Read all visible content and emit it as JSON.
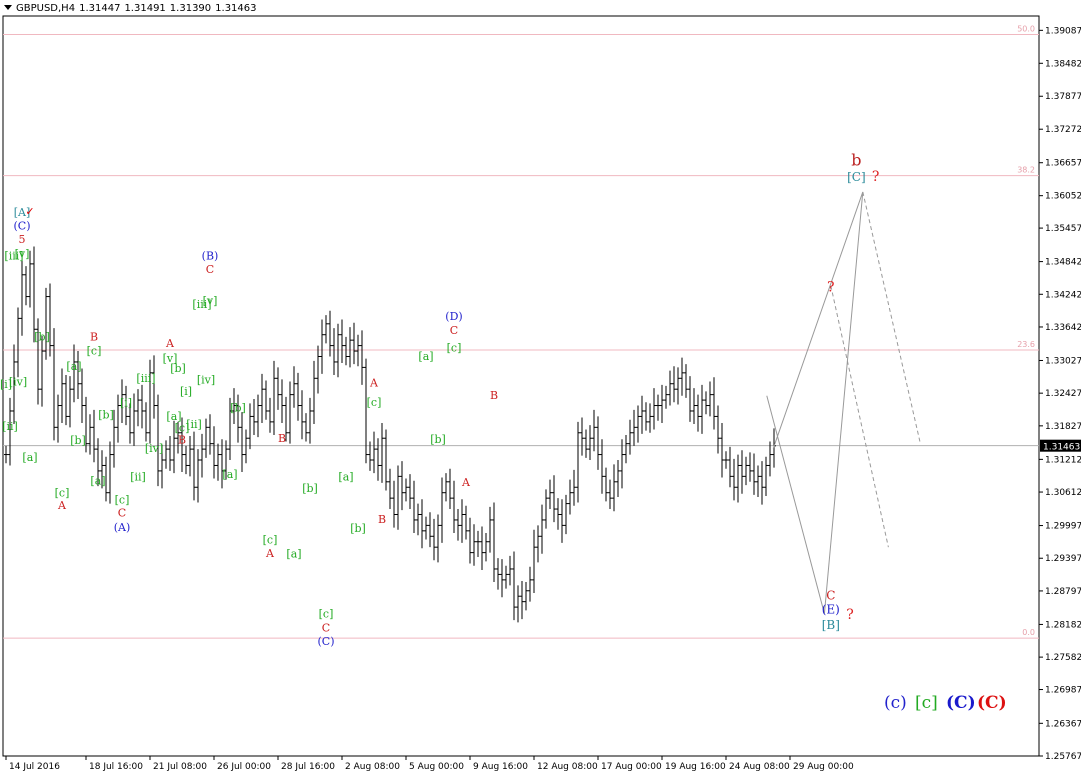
{
  "window": {
    "symbol": "GBPUSD,H4",
    "ohlc": [
      "1.31447",
      "1.31491",
      "1.31390",
      "1.31463"
    ],
    "last_price": "1.31463"
  },
  "chart_data": {
    "type": "candlestick",
    "ylim": [
      1.25767,
      1.3935
    ],
    "yticks": [
      "1.39087",
      "1.38482",
      "1.37877",
      "1.37272",
      "1.36657",
      "1.36052",
      "1.35457",
      "1.34842",
      "1.34242",
      "1.33642",
      "1.33027",
      "1.32427",
      "1.31827",
      "1.31212",
      "1.30612",
      "1.29997",
      "1.29397",
      "1.28797",
      "1.28182",
      "1.27582",
      "1.26987",
      "1.26367",
      "1.25767"
    ],
    "xticks": [
      {
        "label": "14 Jul 2016",
        "bar": 0
      },
      {
        "label": "18 Jul 16:00",
        "bar": 20
      },
      {
        "label": "21 Jul 08:00",
        "bar": 36
      },
      {
        "label": "26 Jul 00:00",
        "bar": 52
      },
      {
        "label": "28 Jul 16:00",
        "bar": 68
      },
      {
        "label": "2 Aug 08:00",
        "bar": 84
      },
      {
        "label": "5 Aug 00:00",
        "bar": 100
      },
      {
        "label": "9 Aug 16:00",
        "bar": 116
      },
      {
        "label": "12 Aug 08:00",
        "bar": 132
      },
      {
        "label": "17 Aug 00:00",
        "bar": 148
      },
      {
        "label": "19 Aug 16:00",
        "bar": 164
      },
      {
        "label": "24 Aug 08:00",
        "bar": 180
      },
      {
        "label": "29 Aug 00:00",
        "bar": 196
      }
    ],
    "bars_total": 206,
    "fib_levels": [
      {
        "label": "50.0",
        "price": 1.3901
      },
      {
        "label": "38.2",
        "price": 1.3642
      },
      {
        "label": "23.6",
        "price": 1.3322
      },
      {
        "label": "0.0",
        "price": 1.2793
      }
    ],
    "current_price_line": 1.31463,
    "closes": [
      1.313,
      1.321,
      1.33,
      1.338,
      1.346,
      1.342,
      1.348,
      1.336,
      1.325,
      1.332,
      1.342,
      1.333,
      1.318,
      1.322,
      1.326,
      1.32,
      1.325,
      1.33,
      1.326,
      1.322,
      1.315,
      1.318,
      1.314,
      1.31,
      1.311,
      1.306,
      1.313,
      1.318,
      1.322,
      1.324,
      1.32,
      1.317,
      1.321,
      1.323,
      1.321,
      1.317,
      1.328,
      1.322,
      1.31,
      1.312,
      1.314,
      1.312,
      1.316,
      1.317,
      1.313,
      1.311,
      1.314,
      1.307,
      1.312,
      1.314,
      1.318,
      1.315,
      1.311,
      1.313,
      1.31,
      1.314,
      1.321,
      1.322,
      1.318,
      1.313,
      1.316,
      1.32,
      1.319,
      1.322,
      1.325,
      1.321,
      1.319,
      1.327,
      1.324,
      1.322,
      1.317,
      1.324,
      1.326,
      1.322,
      1.319,
      1.317,
      1.321,
      1.327,
      1.331,
      1.335,
      1.337,
      1.333,
      1.33,
      1.335,
      1.333,
      1.331,
      1.334,
      1.332,
      1.333,
      1.329,
      1.313,
      1.312,
      1.314,
      1.311,
      1.316,
      1.308,
      1.305,
      1.302,
      1.309,
      1.306,
      1.307,
      1.305,
      1.301,
      1.302,
      1.299,
      1.3,
      1.298,
      1.296,
      1.3,
      1.306,
      1.308,
      1.305,
      1.301,
      1.3,
      1.302,
      1.299,
      1.295,
      1.297,
      1.297,
      1.295,
      1.297,
      1.301,
      1.292,
      1.291,
      1.29,
      1.291,
      1.292,
      1.285,
      1.287,
      1.286,
      1.288,
      1.29,
      1.296,
      1.298,
      1.301,
      1.305,
      1.306,
      1.303,
      1.302,
      1.3,
      1.304,
      1.306,
      1.307,
      1.317,
      1.316,
      1.314,
      1.316,
      1.318,
      1.313,
      1.309,
      1.306,
      1.305,
      1.308,
      1.31,
      1.313,
      1.315,
      1.317,
      1.318,
      1.32,
      1.321,
      1.319,
      1.32,
      1.322,
      1.322,
      1.323,
      1.324,
      1.326,
      1.325,
      1.327,
      1.328,
      1.325,
      1.321,
      1.322,
      1.32,
      1.323,
      1.322,
      1.324,
      1.32,
      1.316,
      1.312,
      1.312,
      1.309,
      1.307,
      1.311,
      1.309,
      1.311,
      1.31,
      1.308,
      1.309,
      1.307,
      1.311,
      1.313,
      1.3146
    ],
    "wave_labels": [
      {
        "t": "[A]",
        "c": "#2a8a9a",
        "bar": 4,
        "p": 1.3568
      },
      {
        "t": "✓",
        "c": "#dd0000",
        "bar": 6,
        "p": 1.357
      },
      {
        "t": "(C)",
        "c": "#2222cc",
        "bar": 4,
        "p": 1.3543
      },
      {
        "t": "5",
        "c": "#cc2222",
        "bar": 4,
        "p": 1.3518
      },
      {
        "t": "[iii]",
        "c": "#22aa22",
        "bar": 2,
        "p": 1.3488
      },
      {
        "t": "[v]",
        "c": "#22aa22",
        "bar": 4,
        "p": 1.3492
      },
      {
        "t": "[iv]",
        "c": "#22aa22",
        "bar": 3,
        "p": 1.3257
      },
      {
        "t": "[i]",
        "c": "#22aa22",
        "bar": 0,
        "p": 1.3252
      },
      {
        "t": "[ii]",
        "c": "#22aa22",
        "bar": 1,
        "p": 1.3175
      },
      {
        "t": "[a]",
        "c": "#22aa22",
        "bar": 6,
        "p": 1.3118
      },
      {
        "t": "[b]",
        "c": "#22aa22",
        "bar": 9,
        "p": 1.3339
      },
      {
        "t": "[c]",
        "c": "#22aa22",
        "bar": 14,
        "p": 1.3053
      },
      {
        "t": "A",
        "c": "#cc2222",
        "bar": 14,
        "p": 1.303
      },
      {
        "t": "[a]",
        "c": "#22aa22",
        "bar": 17,
        "p": 1.3285
      },
      {
        "t": "[b]",
        "c": "#22aa22",
        "bar": 18,
        "p": 1.3149
      },
      {
        "t": "B",
        "c": "#cc2222",
        "bar": 22,
        "p": 1.3339
      },
      {
        "t": "[c]",
        "c": "#22aa22",
        "bar": 22,
        "p": 1.3314
      },
      {
        "t": "[a]",
        "c": "#22aa22",
        "bar": 23,
        "p": 1.3075
      },
      {
        "t": "[b]",
        "c": "#22aa22",
        "bar": 25,
        "p": 1.3196
      },
      {
        "t": "[c]",
        "c": "#22aa22",
        "bar": 29,
        "p": 1.304
      },
      {
        "t": "C",
        "c": "#cc2222",
        "bar": 29,
        "p": 1.3016
      },
      {
        "t": "(A)",
        "c": "#2222cc",
        "bar": 29,
        "p": 1.299
      },
      {
        "t": "[i]",
        "c": "#22aa22",
        "bar": 30,
        "p": 1.3218
      },
      {
        "t": "[ii]",
        "c": "#22aa22",
        "bar": 33,
        "p": 1.3082
      },
      {
        "t": "[iii]",
        "c": "#22aa22",
        "bar": 35,
        "p": 1.3263
      },
      {
        "t": "[iv]",
        "c": "#22aa22",
        "bar": 37,
        "p": 1.3135
      },
      {
        "t": "A",
        "c": "#cc2222",
        "bar": 41,
        "p": 1.3327
      },
      {
        "t": "[v]",
        "c": "#22aa22",
        "bar": 41,
        "p": 1.33
      },
      {
        "t": "[b]",
        "c": "#22aa22",
        "bar": 43,
        "p": 1.3282
      },
      {
        "t": "[i]",
        "c": "#22aa22",
        "bar": 45,
        "p": 1.3239
      },
      {
        "t": "[a]",
        "c": "#22aa22",
        "bar": 42,
        "p": 1.3193
      },
      {
        "t": "[c]",
        "c": "#22aa22",
        "bar": 44,
        "p": 1.3172
      },
      {
        "t": "[ii]",
        "c": "#22aa22",
        "bar": 47,
        "p": 1.3179
      },
      {
        "t": "B",
        "c": "#cc2222",
        "bar": 44,
        "p": 1.315
      },
      {
        "t": "(B)",
        "c": "#2222cc",
        "bar": 51,
        "p": 1.3488
      },
      {
        "t": "C",
        "c": "#cc2222",
        "bar": 51,
        "p": 1.3463
      },
      {
        "t": "[iii]",
        "c": "#22aa22",
        "bar": 49,
        "p": 1.3399
      },
      {
        "t": "[v]",
        "c": "#22aa22",
        "bar": 51,
        "p": 1.3405
      },
      {
        "t": "[iv]",
        "c": "#22aa22",
        "bar": 50,
        "p": 1.326
      },
      {
        "t": "[b]",
        "c": "#22aa22",
        "bar": 58,
        "p": 1.3209
      },
      {
        "t": "[a]",
        "c": "#22aa22",
        "bar": 56,
        "p": 1.3087
      },
      {
        "t": "[c]",
        "c": "#22aa22",
        "bar": 66,
        "p": 1.2967
      },
      {
        "t": "A",
        "c": "#cc2222",
        "bar": 66,
        "p": 1.2942
      },
      {
        "t": "B",
        "c": "#cc2222",
        "bar": 69,
        "p": 1.3153
      },
      {
        "t": "[a]",
        "c": "#22aa22",
        "bar": 72,
        "p": 1.2941
      },
      {
        "t": "[b]",
        "c": "#22aa22",
        "bar": 76,
        "p": 1.3061
      },
      {
        "t": "[c]",
        "c": "#22aa22",
        "bar": 80,
        "p": 1.2831
      },
      {
        "t": "C",
        "c": "#cc2222",
        "bar": 80,
        "p": 1.2805
      },
      {
        "t": "(C)",
        "c": "#2222cc",
        "bar": 80,
        "p": 1.278
      },
      {
        "t": "[a]",
        "c": "#22aa22",
        "bar": 85,
        "p": 1.3082
      },
      {
        "t": "[b]",
        "c": "#22aa22",
        "bar": 88,
        "p": 1.2988
      },
      {
        "t": "A",
        "c": "#cc2222",
        "bar": 92,
        "p": 1.3255
      },
      {
        "t": "[c]",
        "c": "#22aa22",
        "bar": 92,
        "p": 1.3219
      },
      {
        "t": "B",
        "c": "#cc2222",
        "bar": 94,
        "p": 1.3004
      },
      {
        "t": "[a]",
        "c": "#22aa22",
        "bar": 105,
        "p": 1.3304
      },
      {
        "t": "[b]",
        "c": "#22aa22",
        "bar": 108,
        "p": 1.3151
      },
      {
        "t": "(D)",
        "c": "#2222cc",
        "bar": 112,
        "p": 1.3377
      },
      {
        "t": "C",
        "c": "#cc2222",
        "bar": 112,
        "p": 1.3351
      },
      {
        "t": "[c]",
        "c": "#22aa22",
        "bar": 112,
        "p": 1.3319
      },
      {
        "t": "B",
        "c": "#cc2222",
        "bar": 122,
        "p": 1.3232
      },
      {
        "t": "A",
        "c": "#cc2222",
        "bar": 115,
        "p": 1.3072
      }
    ],
    "projections": [
      {
        "path": [
          [
            123,
            1.3141
          ],
          [
            137,
            1.3612
          ],
          [
            131,
            1.2838
          ]
        ],
        "style": "solid"
      },
      {
        "path": [
          [
            122,
            1.3238
          ],
          [
            131,
            1.2838
          ]
        ],
        "style": "solid"
      },
      {
        "path": [
          [
            137,
            1.3612
          ],
          [
            146,
            1.315
          ]
        ],
        "style": "dashed"
      },
      {
        "path": [
          [
            132,
            1.344
          ],
          [
            141,
            1.296
          ]
        ],
        "style": "dashed"
      }
    ],
    "projection_labels": [
      {
        "t": "b",
        "c": "#bb2222",
        "bar": 136,
        "p": 1.3661,
        "size": 16
      },
      {
        "t": "[C]",
        "c": "#2a8a9a",
        "bar": 136,
        "p": 1.3632,
        "size": 12
      },
      {
        "t": "?",
        "c": "#dd2222",
        "bar": 139,
        "p": 1.3632,
        "size": 14
      },
      {
        "t": "?",
        "c": "#dd2222",
        "bar": 132,
        "p": 1.3429,
        "size": 14
      },
      {
        "t": "C",
        "c": "#cc2222",
        "bar": 132,
        "p": 1.2864,
        "size": 12
      },
      {
        "t": "(E)",
        "c": "#2222cc",
        "bar": 132,
        "p": 1.2838,
        "size": 12
      },
      {
        "t": "?",
        "c": "#dd2222",
        "bar": 135,
        "p": 1.2828,
        "size": 14
      },
      {
        "t": "[B]",
        "c": "#2a8a9a",
        "bar": 132,
        "p": 1.281,
        "size": 12
      }
    ],
    "legend": [
      {
        "t": "(c)",
        "c": "#2222cc",
        "weight": "normal"
      },
      {
        "t": "[c]",
        "c": "#22aa22",
        "weight": "normal"
      },
      {
        "t": "(C)",
        "c": "#1a1acc",
        "weight": "bold"
      },
      {
        "t": "(C)",
        "c": "#dd1111",
        "weight": "bold"
      }
    ]
  }
}
